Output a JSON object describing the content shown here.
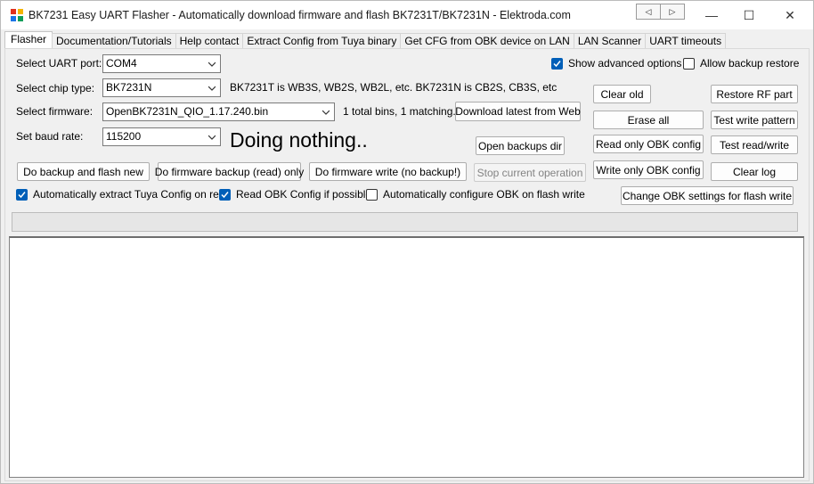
{
  "window": {
    "title": "BK7231 Easy UART Flasher - Automatically download firmware and flash BK7231T/BK7231N  - Elektroda.com",
    "icon": "bk7231-app-icon",
    "nav_prev": "◁",
    "nav_next": "▷",
    "minimize": "—",
    "maximize": "☐",
    "close": "✕"
  },
  "tabs": [
    {
      "label": "Flasher",
      "active": true
    },
    {
      "label": "Documentation/Tutorials"
    },
    {
      "label": "Help contact"
    },
    {
      "label": "Extract Config from Tuya binary"
    },
    {
      "label": "Get CFG from OBK device on LAN"
    },
    {
      "label": "LAN Scanner"
    },
    {
      "label": "UART timeouts"
    }
  ],
  "form": {
    "port_label": "Select UART port:",
    "port_value": "COM4",
    "chip_label": "Select chip type:",
    "chip_value": "BK7231N",
    "chip_note": "BK7231T is WB3S, WB2S, WB2L, etc. BK7231N is CB2S, CB3S, etc",
    "firmware_label": "Select firmware:",
    "firmware_value": "OpenBK7231N_QIO_1.17.240.bin",
    "firmware_note": "1 total bins, 1 matching.",
    "baud_label": "Set baud rate:",
    "baud_value": "115200",
    "status_text": "Doing nothing.."
  },
  "options": {
    "show_advanced": {
      "label": "Show advanced options",
      "checked": true
    },
    "allow_backup_restore": {
      "label": "Allow backup restore",
      "checked": false
    },
    "extract_tuya": {
      "label": "Automatically extract Tuya Config on read",
      "checked": true
    },
    "read_obk": {
      "label": "Read OBK Config if possible",
      "checked": true
    },
    "auto_configure": {
      "label": "Automatically configure OBK on flash write",
      "checked": false
    }
  },
  "buttons": {
    "download_latest": "Download latest from Web",
    "open_backups": "Open backups dir",
    "backup_and_flash": "Do backup and flash new",
    "firmware_backup": "Do firmware backup (read) only",
    "firmware_write": "Do firmware write (no backup!)",
    "stop_operation": "Stop current operation",
    "clear_old": "Clear old",
    "restore_rf": "Restore RF part",
    "erase_all": "Erase all",
    "test_write_pattern": "Test write pattern",
    "read_obk_config": "Read only OBK config",
    "test_read_write": "Test read/write",
    "write_obk_config": "Write only OBK config",
    "clear_log": "Clear log",
    "change_obk_settings": "Change OBK settings for flash write"
  },
  "progress": {
    "value": 0
  },
  "log": {
    "text": ""
  }
}
